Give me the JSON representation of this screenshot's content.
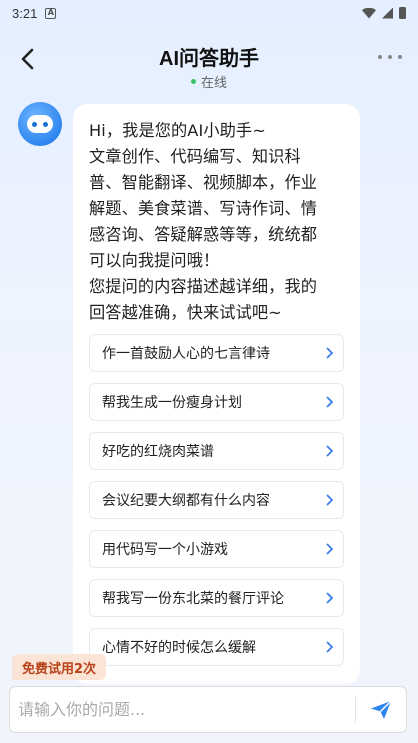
{
  "status_bar": {
    "time": "3:21",
    "app_badge": "A"
  },
  "header": {
    "title": "AI问答助手",
    "status": "在线"
  },
  "message": {
    "greeting": "Hi，我是您的AI小助手~\n文章创作、代码编写、知识科\n普、智能翻译、视频脚本，作业\n解题、美食菜谱、写诗作词、情\n感咨询、答疑解惑等等，统统都\n可以向我提问哦！\n您提问的内容描述越详细，我的\n回答越准确，快来试试吧~"
  },
  "suggestions": [
    "作一首鼓励人心的七言律诗",
    "帮我生成一份瘦身计划",
    "好吃的红烧肉菜谱",
    "会议纪要大纲都有什么内容",
    "用代码写一个小游戏",
    "帮我写一份东北菜的餐厅评论",
    "心情不好的时候怎么缓解"
  ],
  "trial_badge": "免费试用2次",
  "input": {
    "placeholder": "请输入你的问题...",
    "value": ""
  },
  "colors": {
    "accent": "#2e86f0",
    "online": "#36c36a",
    "trial_text": "#b8421a",
    "trial_bg": "#fbe3d6"
  }
}
